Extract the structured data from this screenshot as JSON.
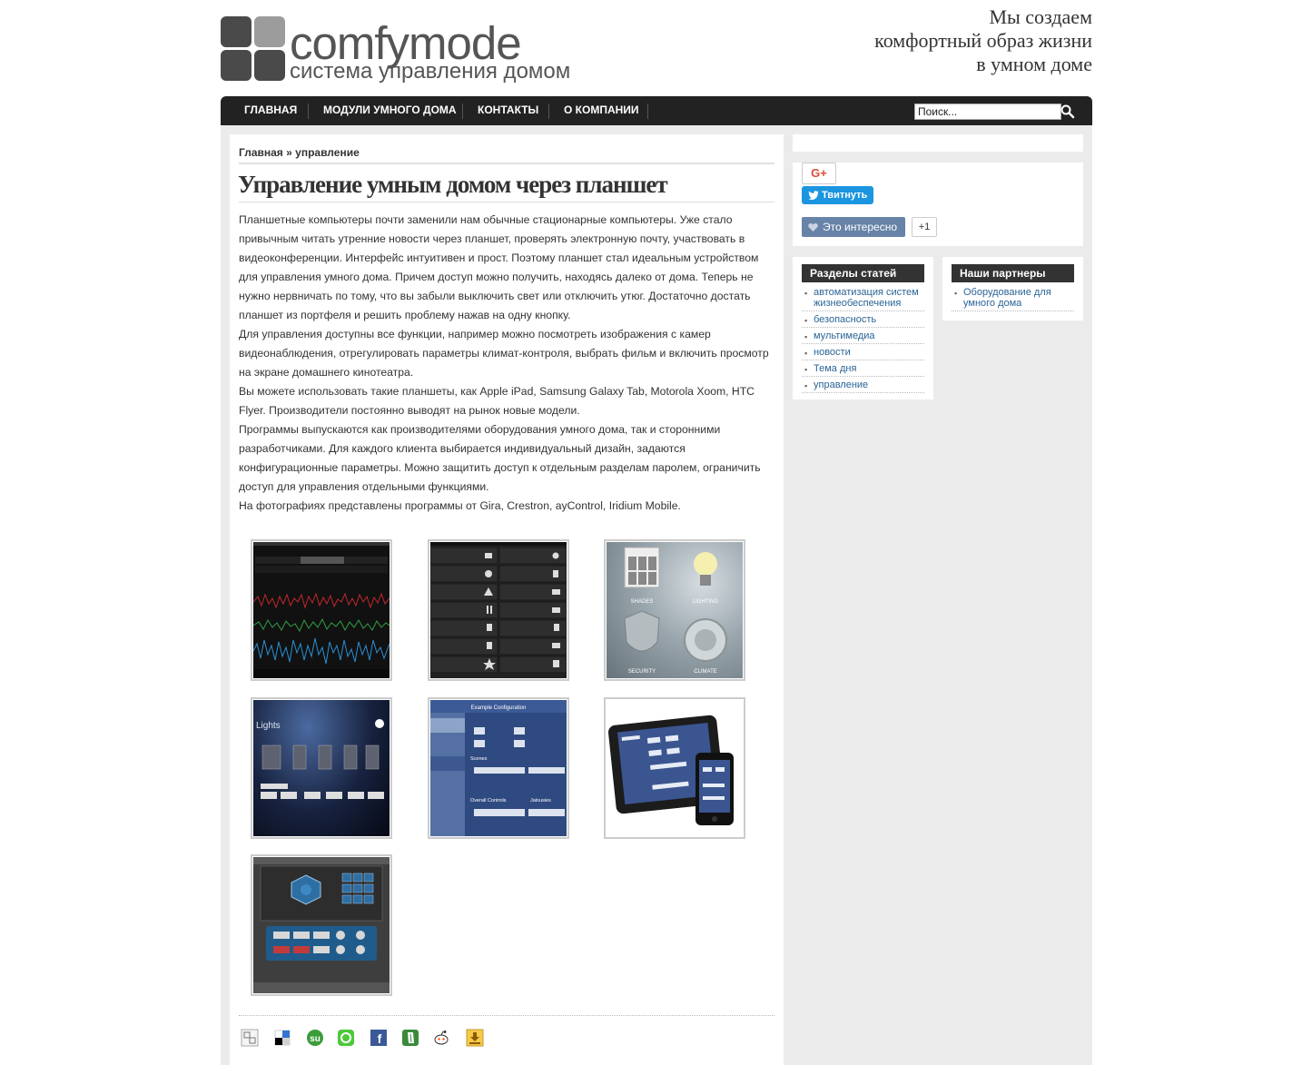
{
  "header": {
    "logo_word": "comfymode",
    "logo_tagline": "система управления домом",
    "slogan": [
      "Мы создаем",
      "комфортный образ жизни",
      "в умном доме"
    ]
  },
  "nav": {
    "items": [
      "Главная",
      "Модули умного дома",
      "Контакты",
      "О компании"
    ],
    "search_value": "Поиск..."
  },
  "breadcrumb": {
    "home": "Главная",
    "separator": " » ",
    "current": "управление"
  },
  "article": {
    "title": "Управление умным домом через планшет",
    "paragraphs": [
      "Планшетные компьютеры почти заменили нам обычные стационарные компьютеры. Уже стало привычным читать утренние новости через планшет, проверять электронную почту, участвовать в видеоконференции. Интерфейс интуитивен и прост. Поэтому планшет стал идеальным устройством для управления умного дома. Причем доступ можно получить, находясь далеко от дома. Теперь не нужно нервничать по тому, что вы забыли выключить свет или отключить утюг. Достаточно достать планшет из портфеля и решить проблему нажав на одну кнопку.",
      "Для управления доступны все функции, например можно посмотреть изображения с камер видеонаблюдения, отрегулировать параметры климат-контроля, выбрать фильм и включить просмотр на экране домашнего кинотеатра.",
      "Вы можете использовать такие планшеты, как Apple iPad, Samsung Galaxy Tab, Motorola Xoom, HTC Flyer. Производители постоянно выводят на рынок новые модели.",
      "Программы выпускаются как производителями оборудования умного дома, так и сторонними разработчиками. Для каждого клиента выбирается индивидуальный дизайн, задаются конфигурационные параметры. Можно защитить доступ к отдельным разделам паролем, ограничить доступ для управления отдельными функциями.",
      "На фотографиях представлены программы от Gira, Crestron, ayControl, Iridium Mobile."
    ]
  },
  "gallery": {
    "thumb_labels": {
      "shades": "SHADES",
      "lighting": "LIGHTING",
      "security": "SECURITY",
      "climate": "CLIMATE",
      "lights": "Lights",
      "example_config": "Example Configuration",
      "scenes": "Scenes",
      "overall_controls": "Overall Controls",
      "jalousies": "Jalousies"
    }
  },
  "share_icons": [
    "bookmark-icon",
    "delicious-icon",
    "stumbleupon-icon",
    "technorati-icon",
    "facebook-icon",
    "evernote-icon",
    "reddit-icon",
    "download-icon"
  ],
  "sidebar": {
    "gplus_label": "G+",
    "tweet_label": "Твитнуть",
    "like_label": "Это интересно",
    "like_count": "+1",
    "sections_title": "Разделы статей",
    "sections": [
      "автоматизация систем жизнеобеспечения",
      "безопасность",
      "мультимедиа",
      "новости",
      "Тема дня",
      "управление"
    ],
    "partners_title": "Наши партнеры",
    "partners": [
      "Оборудование для умного дома"
    ]
  },
  "colors": {
    "nav_bg": "#222222",
    "sidebar_bg": "#ebebeb",
    "link": "#2a6496",
    "tweet": "#1b95e0",
    "like": "#6783a8"
  }
}
